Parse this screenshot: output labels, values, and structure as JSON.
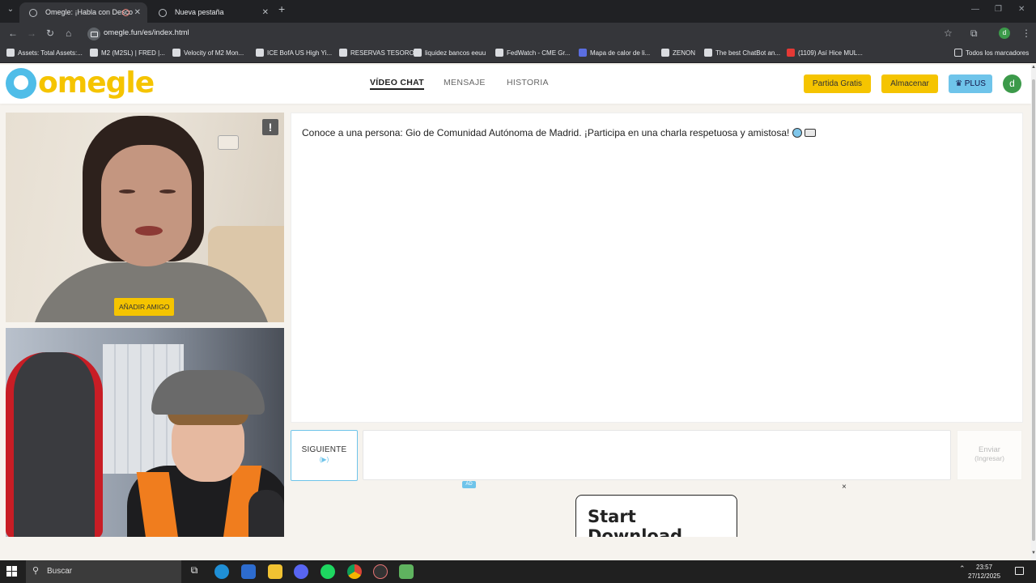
{
  "browser": {
    "tabs": [
      {
        "title": "Omegle: ¡Habla con Desco",
        "active": true
      },
      {
        "title": "Nueva pestaña",
        "active": false
      }
    ],
    "url": "omegle.fun/es/index.html",
    "profile_initial": "d",
    "bookmarks": [
      "Assets: Total Assets:...",
      "M2 (M2SL) | FRED |...",
      "Velocity of M2 Mon...",
      "ICE BofA US High Yi...",
      "RESERVAS TESORO",
      "liquidez bancos eeuu",
      "FedWatch - CME Gr...",
      "Mapa de calor de li...",
      "ZENON",
      "The best ChatBot an...",
      "(1109) Así Hice MUL..."
    ],
    "all_bookmarks": "Todos los marcadores"
  },
  "site": {
    "logo_text": "omegle",
    "nav": [
      "VÍDEO CHAT",
      "MENSAJE",
      "HISTORIA"
    ],
    "buttons": {
      "free_game": "Partida Gratis",
      "store": "Almacenar",
      "plus": "♛ PLUS"
    },
    "avatar_initial": "d",
    "accent_yellow": "#f5c400",
    "accent_blue": "#6fc4ea"
  },
  "video": {
    "report_label": "!",
    "add_friend": "AÑADIR AMIGO"
  },
  "chat": {
    "intro_message": "Conoce a una persona: Gio de Comunidad Autónoma de Madrid. ¡Participa en una charla respetuosa y amistosa!",
    "next_label": "SIGUIENTE",
    "next_hint": "(▶)",
    "send_label": "Enviar",
    "send_hint": "(Ingresar)",
    "input_value": ""
  },
  "ad": {
    "tag": "AD",
    "close": "×",
    "download_text": "Start Download (Free)"
  },
  "taskbar": {
    "search_placeholder": "Buscar",
    "time": "23:57",
    "date": "27/12/2025"
  }
}
